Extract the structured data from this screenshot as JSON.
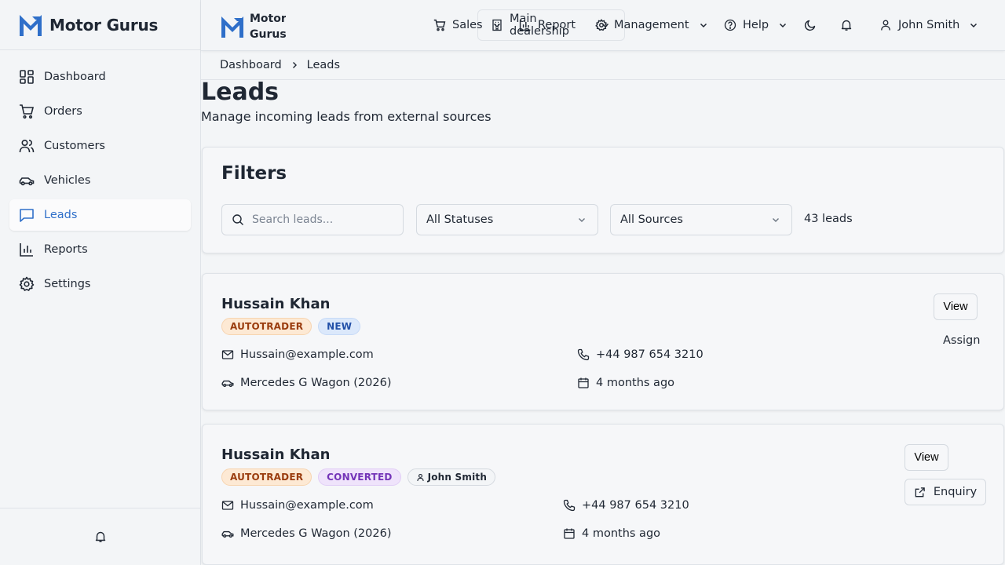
{
  "brand": {
    "name": "Motor Gurus",
    "header_name": "Motor Gurus",
    "accent": "#2f6fc9"
  },
  "sidebar": {
    "items": [
      {
        "label": "Dashboard",
        "icon": "dashboard-icon"
      },
      {
        "label": "Orders",
        "icon": "cart-icon"
      },
      {
        "label": "Customers",
        "icon": "users-icon"
      },
      {
        "label": "Vehicles",
        "icon": "car-icon"
      },
      {
        "label": "Leads",
        "icon": "message-icon",
        "active": true
      },
      {
        "label": "Reports",
        "icon": "bar-chart-icon"
      },
      {
        "label": "Settings",
        "icon": "gear-icon"
      }
    ]
  },
  "header": {
    "dealership": "Main dealership",
    "menus": {
      "sales": "Sales",
      "report": "Report",
      "management": "Management",
      "help": "Help"
    },
    "user": "John Smith"
  },
  "breadcrumb": {
    "root": "Dashboard",
    "current": "Leads"
  },
  "page": {
    "title": "Leads",
    "subtitle": "Manage incoming leads from external sources"
  },
  "filters": {
    "title": "Filters",
    "search_placeholder": "Search leads...",
    "status": "All Statuses",
    "source": "All Sources",
    "count": "43 leads"
  },
  "leads": [
    {
      "name": "Hussain Khan",
      "source": "AUTOTRADER",
      "status": "NEW",
      "email": "Hussain@example.com",
      "phone": "+44 987 654 3210",
      "vehicle": "Mercedes G Wagon (2026)",
      "time": "4 months ago",
      "actions": {
        "view": "View",
        "assign": "Assign"
      }
    },
    {
      "name": "Hussain Khan",
      "source": "AUTOTRADER",
      "status": "CONVERTED",
      "assignee": "John Smith",
      "email": "Hussain@example.com",
      "phone": "+44 987 654 3210",
      "vehicle": "Mercedes G Wagon (2026)",
      "time": "4 months ago",
      "actions": {
        "view": "View",
        "enquiry": "Enquiry"
      }
    }
  ]
}
